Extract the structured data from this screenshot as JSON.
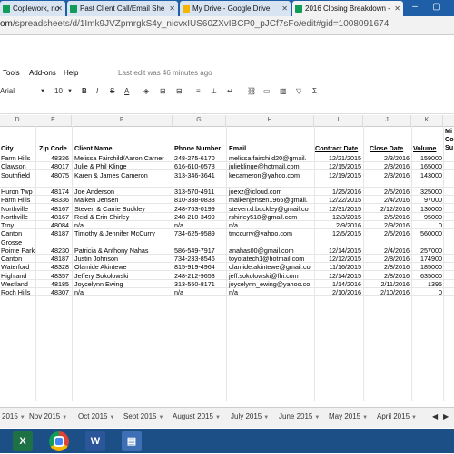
{
  "browser": {
    "tabs": [
      {
        "label": "Coplework, no"
      },
      {
        "label": "Past Client Call/Email She"
      },
      {
        "label": "My Drive - Google Drive"
      },
      {
        "label": "2016 Closing Breakdown -"
      }
    ],
    "address": {
      "url_domain": "om",
      "url_path": "/spreadsheets/d/1Imk9JVZpmrgkS4y_nicvxIUS60ZXvIBCP0_pJCf7sFo/edit#gid=1008091674"
    }
  },
  "menubar": {
    "tools": "Tools",
    "addons": "Add-ons",
    "help": "Help",
    "last_edit": "Last edit was 46 minutes ago"
  },
  "toolbar": {
    "font": "Arial",
    "font_size": "10",
    "bold": "B",
    "italic": "I",
    "strike": "S",
    "text_color": "A"
  },
  "columns": [
    "D",
    "E",
    "F",
    "G",
    "H",
    "I",
    "J",
    "K"
  ],
  "headers": {
    "city": "City",
    "zip": "Zip Code",
    "client": "Client Name",
    "phone": "Phone Number",
    "email": "Email",
    "contract": "Contract Date",
    "close": "Close Date",
    "volume": "Volume",
    "extra_1": "Mi",
    "extra_2": "Co",
    "extra_3": "Su"
  },
  "rows": [
    {
      "city": "Farm Hills",
      "zip": "48336",
      "client": "Melissa Fairchild/Aaron Carner",
      "phone": "248-275-6170",
      "email": "melissa.fairchild20@gmail.",
      "contract": "12/21/2015",
      "close": "2/3/2016",
      "volume": "159000"
    },
    {
      "city": "Clawson",
      "zip": "48017",
      "client": "Julie & Phil Klinge",
      "phone": "616-610-0578",
      "email": "julieklinge@hotmail.com",
      "contract": "12/15/2015",
      "close": "2/3/2016",
      "volume": "165000"
    },
    {
      "city": "Southfield",
      "zip": "48075",
      "client": "Karen & James Cameron",
      "phone": "313-346-3641",
      "email": "kecameron@yahoo.com",
      "contract": "12/19/2015",
      "close": "2/3/2016",
      "volume": "143000"
    },
    {
      "city": "",
      "zip": "",
      "client": "",
      "phone": "",
      "email": "",
      "contract": "",
      "close": "",
      "volume": ""
    },
    {
      "city": "Huron Twp",
      "zip": "48174",
      "client": "Joe Anderson",
      "phone": "313-570-4911",
      "email": "joexz@icloud.com",
      "contract": "1/25/2016",
      "close": "2/5/2016",
      "volume": "325000"
    },
    {
      "city": "Farm Hills",
      "zip": "48336",
      "client": "Maiken Jensen",
      "phone": "810-338-0833",
      "email": "maikenjensen1966@gmail.",
      "contract": "12/22/2015",
      "close": "2/4/2016",
      "volume": "97000"
    },
    {
      "city": "Northville",
      "zip": "48167",
      "client": "Steven & Carrie Buckley",
      "phone": "248-763-0199",
      "email": "steven.d.buckley@gmail.co",
      "contract": "12/31/2015",
      "close": "2/12/2016",
      "volume": "130000"
    },
    {
      "city": "Northville",
      "zip": "48167",
      "client": "Reid & Erin Shirley",
      "phone": "248-210-3499",
      "email": "rshirley518@gmail.com",
      "contract": "12/3/2015",
      "close": "2/5/2016",
      "volume": "95000"
    },
    {
      "city": "Troy",
      "zip": "48084",
      "client": "n/a",
      "phone": "n/a",
      "email": "n/a",
      "contract": "2/9/2016",
      "close": "2/9/2016",
      "volume": "0"
    },
    {
      "city": "Canton",
      "zip": "48187",
      "client": "Timothy & Jennifer McCurry",
      "phone": "734-625-9589",
      "email": "tmccurry@yahoo.com",
      "contract": "12/5/2015",
      "close": "2/5/2016",
      "volume": "560000"
    },
    {
      "city": "Grosse",
      "zip": "",
      "client": "",
      "phone": "",
      "email": "",
      "contract": "",
      "close": "",
      "volume": ""
    },
    {
      "city": "Pointe Park",
      "zip": "48230",
      "client": "Patricia & Anthony Nahas",
      "phone": "586-549-7917",
      "email": "anahas00@gmail.com",
      "contract": "12/14/2015",
      "close": "2/4/2016",
      "volume": "257000"
    },
    {
      "city": "Canton",
      "zip": "48187",
      "client": "Justin Johnson",
      "phone": "734-233-8546",
      "email": "toyotatech1@hotmail.com",
      "contract": "12/12/2015",
      "close": "2/8/2016",
      "volume": "174900"
    },
    {
      "city": "Waterford",
      "zip": "48328",
      "client": "Olamide Akintewe",
      "phone": "815-919-4964",
      "email": "olamide.akintewe@gmail.co",
      "contract": "11/16/2015",
      "close": "2/8/2016",
      "volume": "185000"
    },
    {
      "city": "Highland",
      "zip": "48357",
      "client": "Jeffery Sokolowski",
      "phone": "248-212-9653",
      "email": "jeff.sokolowski@fhi.com",
      "contract": "12/14/2015",
      "close": "2/8/2016",
      "volume": "635000"
    },
    {
      "city": "Westland",
      "zip": "48185",
      "client": "Joycelynn Ewing",
      "phone": "313-550-8171",
      "email": "joycelynn_ewing@yahoo.co",
      "contract": "1/14/2016",
      "close": "2/11/2016",
      "volume": "1395"
    },
    {
      "city": "Roch Hills",
      "zip": "48307",
      "client": "n/a",
      "phone": "n/a",
      "email": "n/a",
      "contract": "2/10/2016",
      "close": "2/10/2016",
      "volume": "0"
    }
  ],
  "sheet_tabs": [
    "2015",
    "Nov 2015",
    "Oct 2015",
    "Sept 2015",
    "August 2015",
    "July 2015",
    "June 2015",
    "May 2015",
    "April 2015"
  ],
  "taskbar": {
    "icons": [
      "excel-icon",
      "chrome-icon",
      "word-icon",
      "store-icon"
    ]
  },
  "colors": {
    "tabstrip": "#1f5fa8",
    "taskbar": "#1b4f86",
    "sheets_green": "#0f9d58"
  }
}
